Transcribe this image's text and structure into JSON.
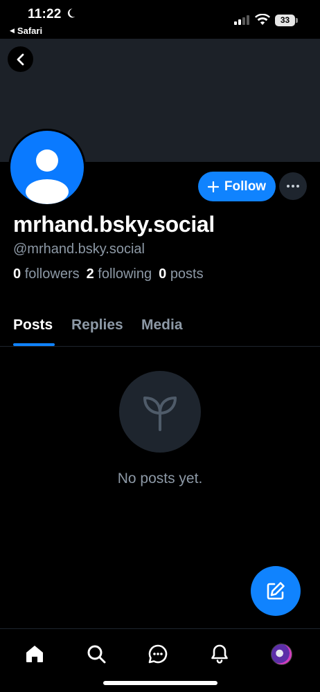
{
  "status_bar": {
    "time": "11:22",
    "back_app": "Safari",
    "battery": "33"
  },
  "profile": {
    "display_name": "mrhand.bsky.social",
    "handle": "@mrhand.bsky.social",
    "followers_count": "0",
    "followers_label": "followers",
    "following_count": "2",
    "following_label": "following",
    "posts_count": "0",
    "posts_label": "posts"
  },
  "actions": {
    "follow_label": "Follow"
  },
  "tabs": [
    {
      "label": "Posts",
      "active": true
    },
    {
      "label": "Replies",
      "active": false
    },
    {
      "label": "Media",
      "active": false
    }
  ],
  "empty_state": {
    "icon": "sprout-icon",
    "message": "No posts yet."
  },
  "bottom_nav": [
    {
      "icon": "home-icon"
    },
    {
      "icon": "search-icon"
    },
    {
      "icon": "chat-icon"
    },
    {
      "icon": "bell-icon"
    },
    {
      "icon": "profile-avatar"
    }
  ],
  "colors": {
    "accent": "#1083fe",
    "banner": "#1c2128",
    "muted_text": "#8d99a6",
    "avatar_bg": "#0a7aff"
  }
}
